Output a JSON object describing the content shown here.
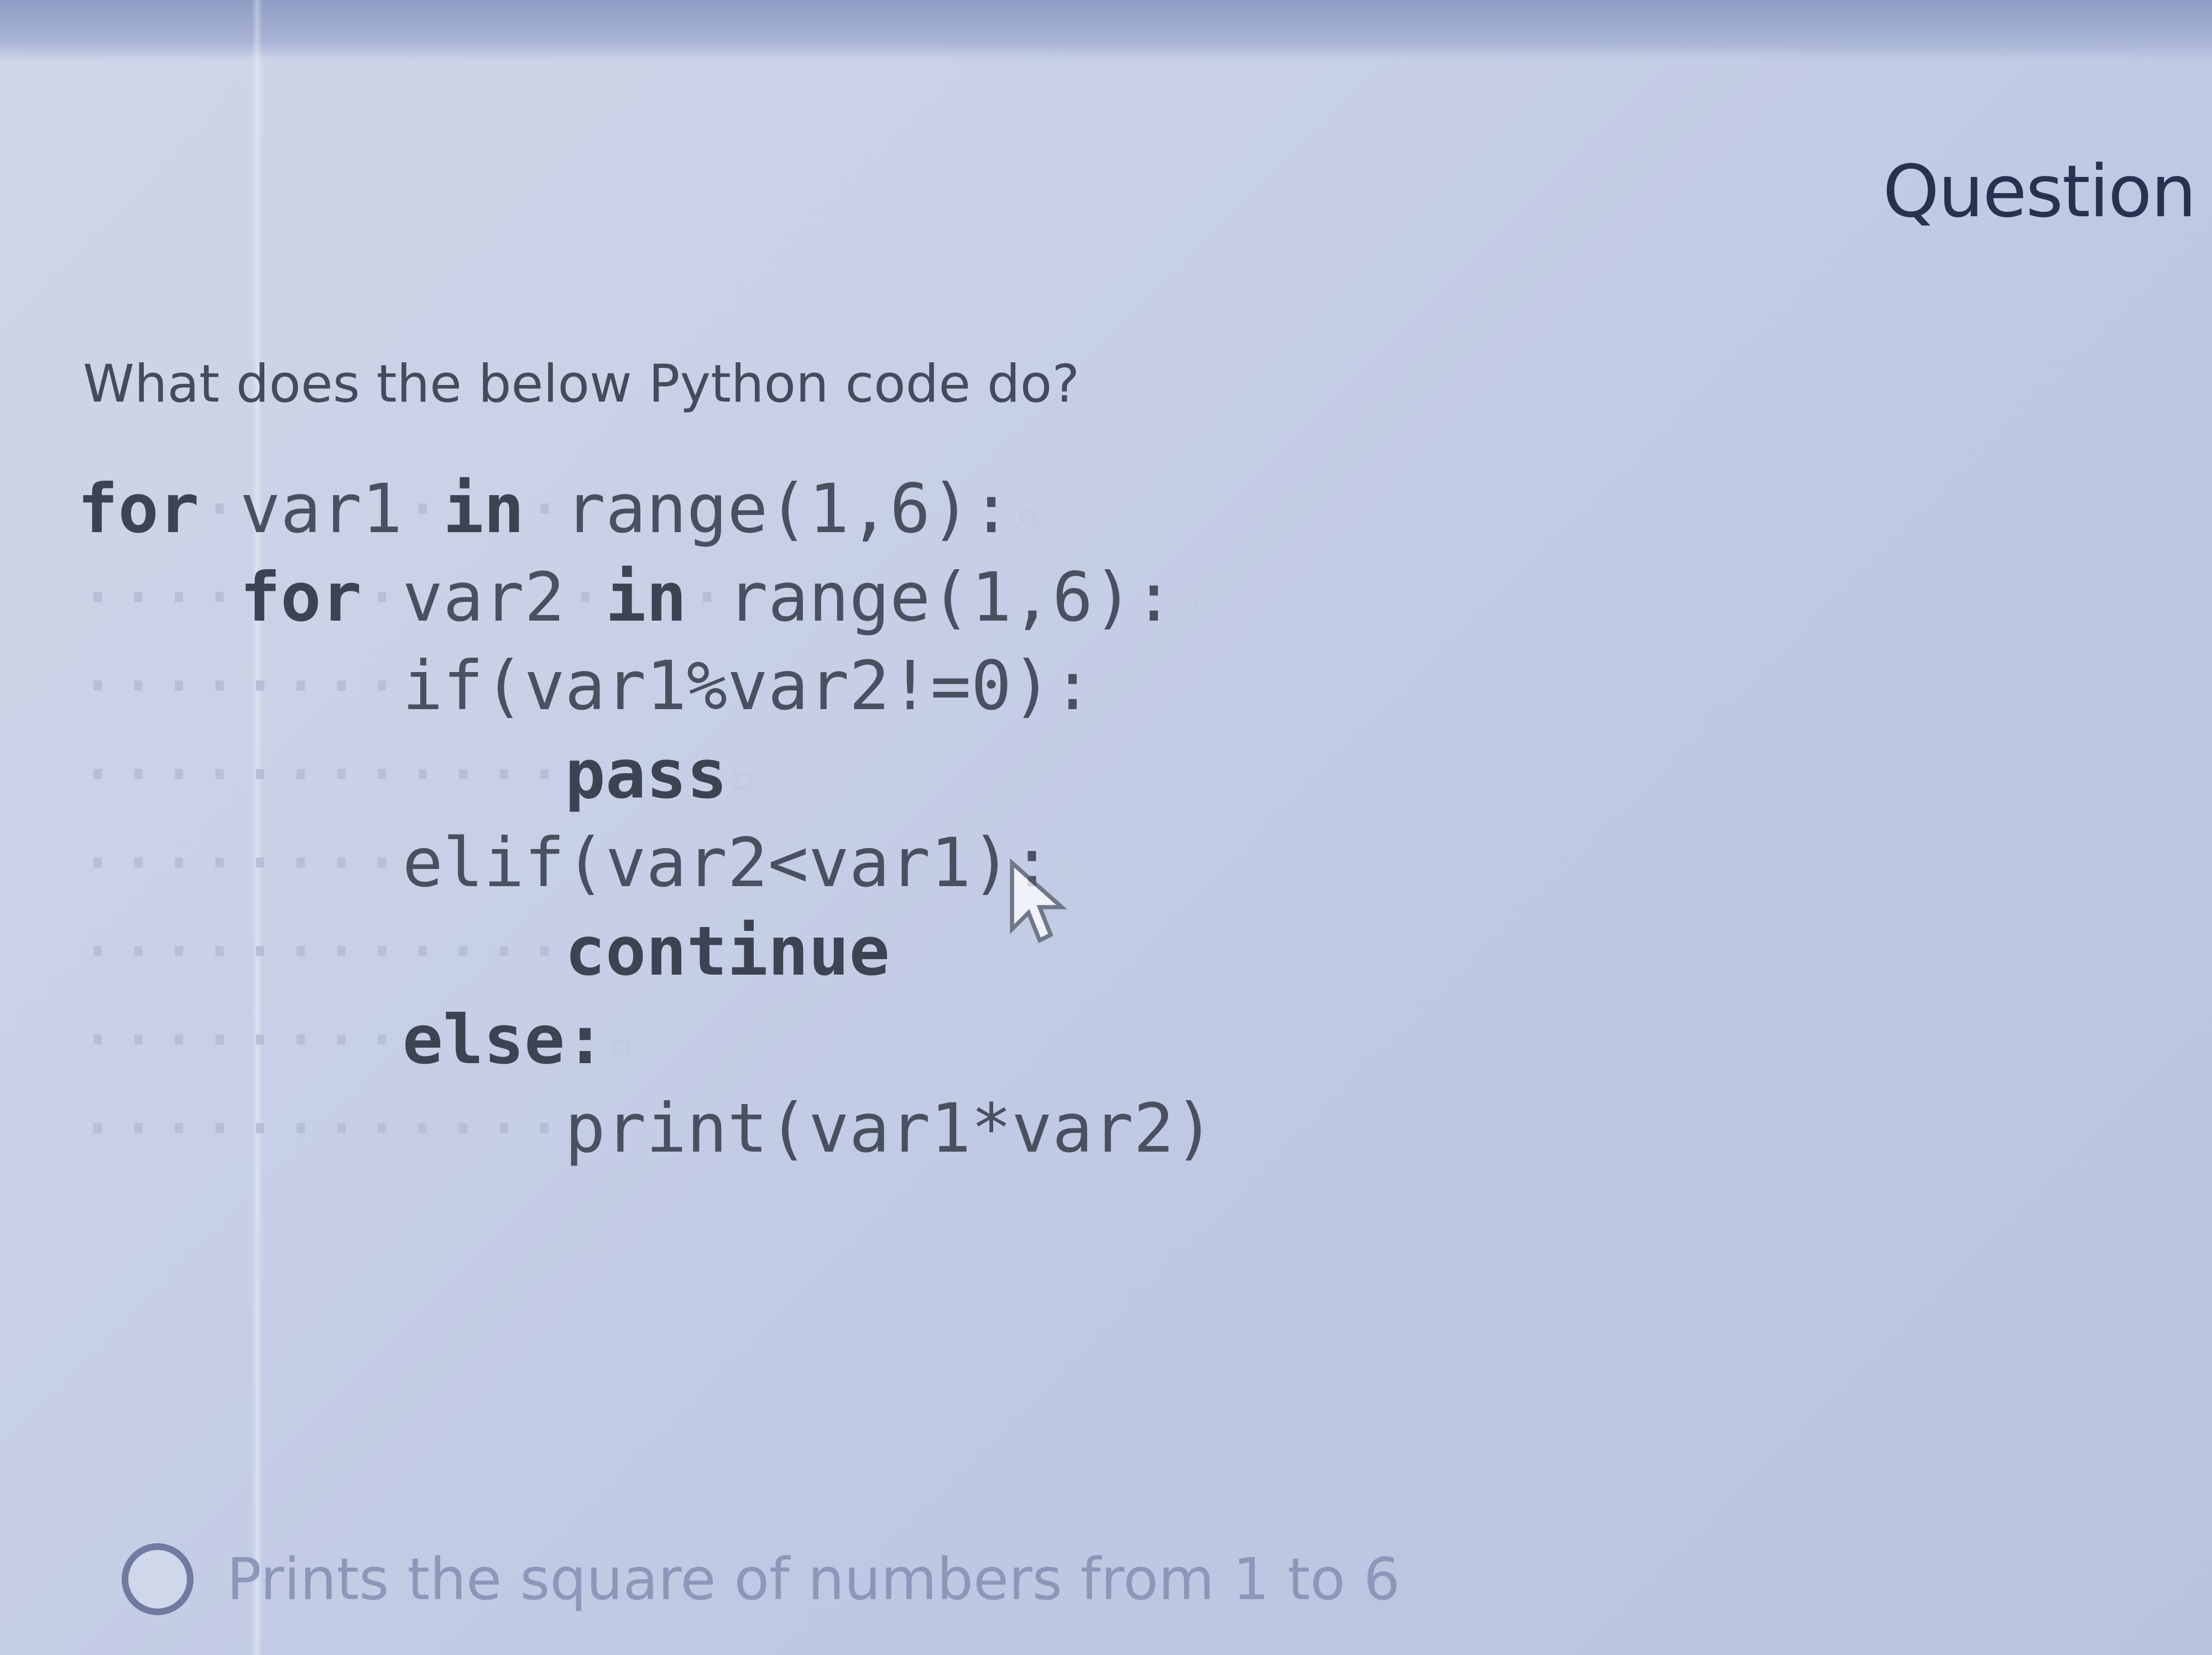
{
  "header": {
    "title": "Question"
  },
  "question": {
    "text": "What does the below Python code do?"
  },
  "code": {
    "lines": [
      {
        "indent": "",
        "tokens": [
          "for",
          "var1",
          "in",
          "range(1,6):"
        ]
      },
      {
        "indent": "····",
        "tokens": [
          "for",
          "var2",
          "in",
          "range(1,6):"
        ]
      },
      {
        "indent": "········",
        "text": "if(var1%var2!=0):"
      },
      {
        "indent": "············",
        "text": "pass"
      },
      {
        "indent": "········",
        "text": "elif(var2<var1):"
      },
      {
        "indent": "············",
        "text": "continue"
      },
      {
        "indent": "········",
        "text": "else:"
      },
      {
        "indent": "············",
        "text": "print(var1*var2)"
      }
    ],
    "line_end_marker": "¤"
  },
  "options": [
    {
      "label": "Prints the square of numbers from 1 to 6",
      "selected": false
    }
  ],
  "icons": {
    "cursor": "mouse-pointer-icon",
    "radio": "radio-empty-icon"
  },
  "colors": {
    "heading": "#273250",
    "code_text": "#4a5060",
    "option_text": "#8d97b9",
    "background": "#c7d0e6"
  }
}
